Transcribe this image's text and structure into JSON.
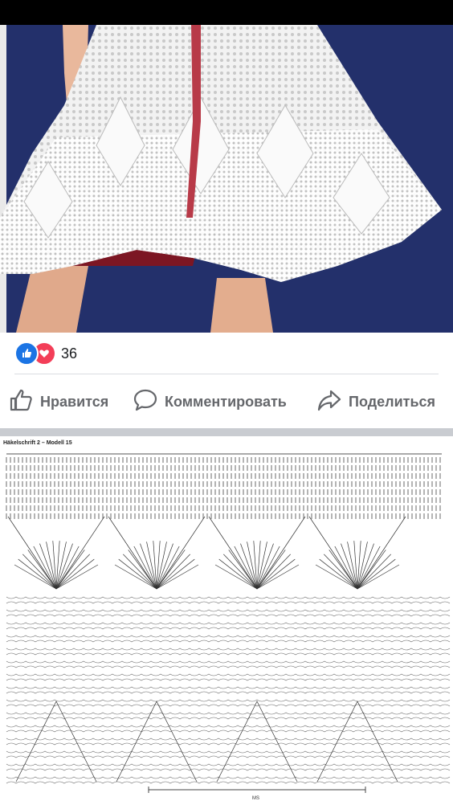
{
  "post": {
    "reactions": {
      "count": "36",
      "icons": [
        "like-icon",
        "love-icon"
      ]
    },
    "actions": [
      {
        "name": "like-button",
        "icon": "thumbs-up-icon",
        "label": "Нравится"
      },
      {
        "name": "comment-button",
        "icon": "speech-bubble-icon",
        "label": "Комментировать"
      },
      {
        "name": "share-button",
        "icon": "share-arrow-icon",
        "label": "Поделиться"
      }
    ]
  },
  "diagram": {
    "title": "Häkelschrift 2 – Modell 15",
    "footer_mark": "MS"
  },
  "colors": {
    "like_blue": "#1b74e4",
    "love_red": "#f33e58",
    "photo_background": "#23306b",
    "action_gray": "#65676b"
  }
}
